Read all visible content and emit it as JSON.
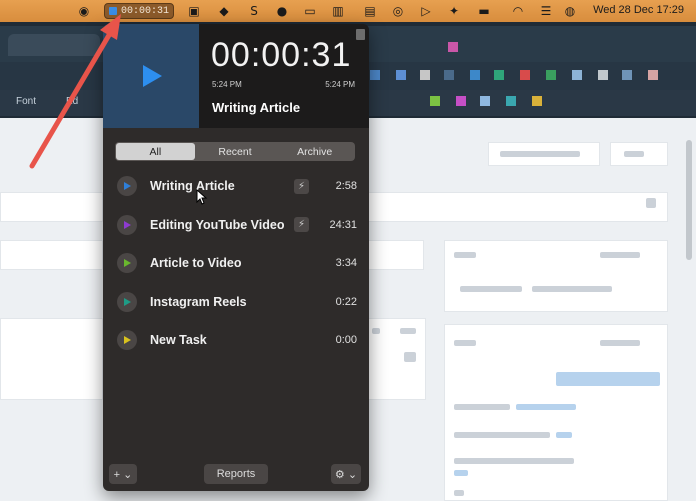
{
  "menubar": {
    "timer_text": "00:00:31",
    "clock": "Wed 28 Dec  17:29",
    "icons": [
      "camera-icon",
      "tracker-icon",
      "dropbox-icon",
      "s-icon",
      "vpn-icon",
      "screen-icon",
      "layout-icon",
      "calendar-icon",
      "airdrop-icon",
      "play-icon",
      "run-icon",
      "battery-icon",
      "wifi-icon",
      "control-center-icon",
      "siri-icon"
    ]
  },
  "background": {
    "toolbar_font": "Font",
    "toolbar_edit": "Ed"
  },
  "popup": {
    "elapsed": "00:00:31",
    "start_time": "5:24 PM",
    "end_time": "5:24 PM",
    "current_task": "Writing Article",
    "tabs": [
      "All",
      "Recent",
      "Archive"
    ],
    "active_tab": "All",
    "tasks": [
      {
        "name": "Writing Article",
        "duration": "2:58",
        "color": "#2f7fd8",
        "bolt": true
      },
      {
        "name": "Editing YouTube Video",
        "duration": "24:31",
        "color": "#8e3bd0",
        "bolt": true
      },
      {
        "name": "Article to Video",
        "duration": "3:34",
        "color": "#6ab82e",
        "bolt": false
      },
      {
        "name": "Instagram Reels",
        "duration": "0:22",
        "color": "#1e9c86",
        "bolt": false
      },
      {
        "name": "New Task",
        "duration": "0:00",
        "color": "#d9c21e",
        "bolt": false
      }
    ],
    "footer": {
      "add_label": "+ ⌄",
      "reports_label": "Reports",
      "settings_label": "⚙ ⌄"
    }
  },
  "colors": {
    "menubar": "#e39b4c",
    "arrow": "#e8544a",
    "play_accent": "#2d8ff0"
  }
}
